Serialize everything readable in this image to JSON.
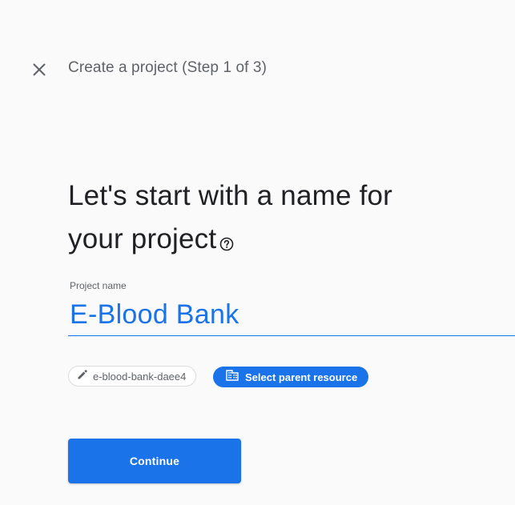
{
  "header": {
    "close_icon": "close-icon",
    "step_title": "Create a project (Step 1 of 3)"
  },
  "main": {
    "headline_line1": "Let's start with a name for",
    "headline_line2": "your project",
    "help_icon": "help-circle-icon",
    "project_name_label": "Project name",
    "project_name_value": "E-Blood Bank",
    "project_id_icon": "pencil-icon",
    "project_id": "e-blood-bank-daee4",
    "parent_resource_icon": "organization-icon",
    "parent_resource_label": "Select parent resource",
    "continue_label": "Continue"
  },
  "colors": {
    "accent": "#1a73e8",
    "text_primary": "#202124",
    "text_secondary": "#5f6368",
    "background": "#fafafa"
  }
}
